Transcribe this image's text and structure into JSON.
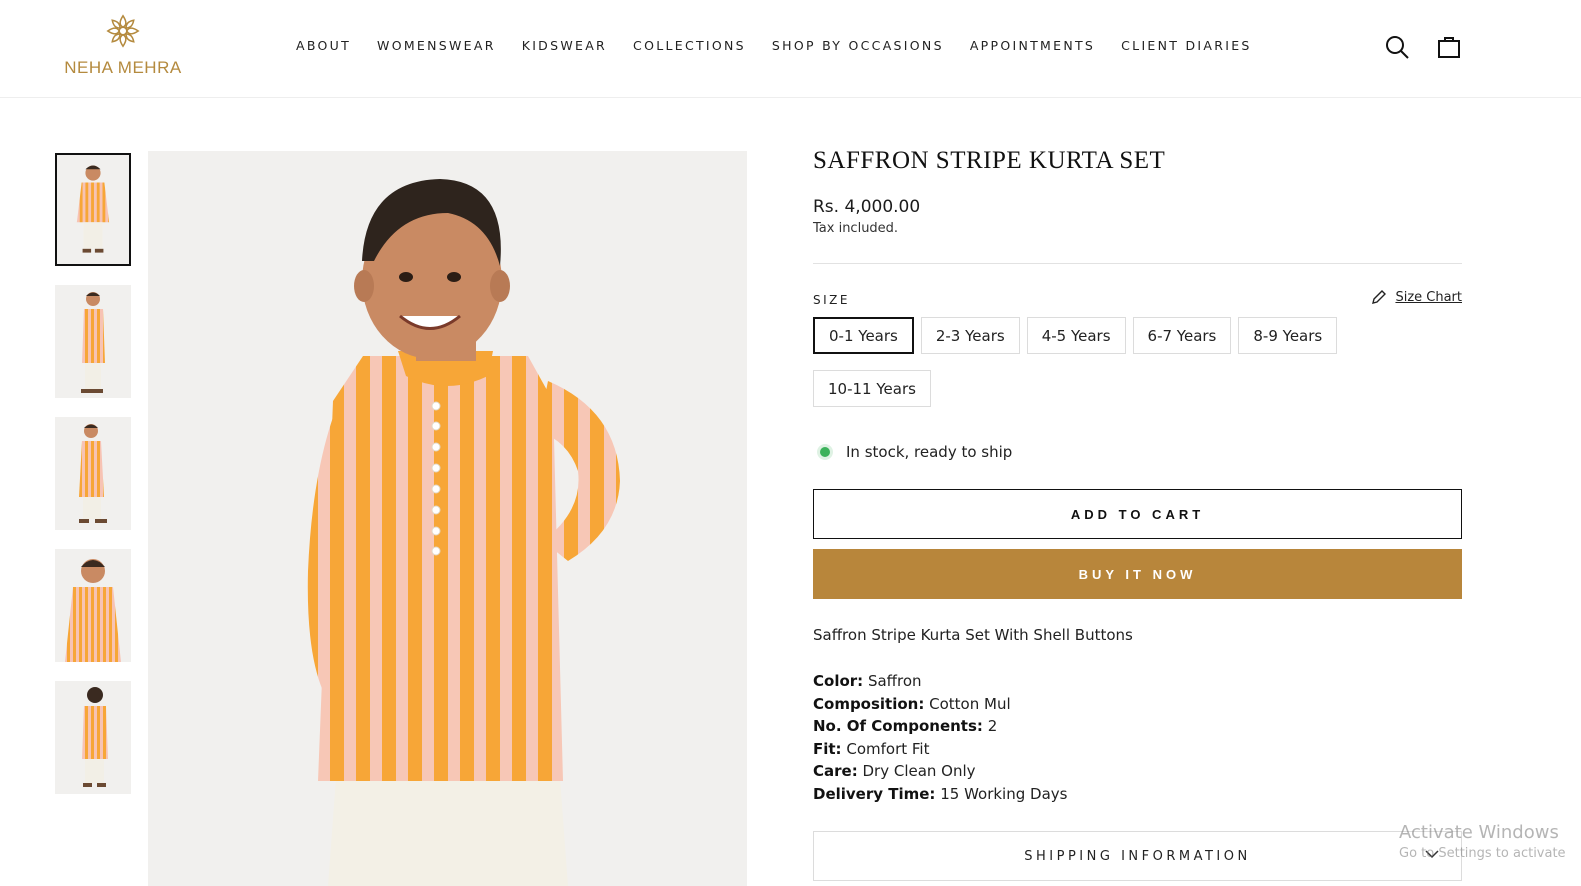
{
  "brand": {
    "name": "NEHA MEHRA",
    "color": "#b48a3e"
  },
  "nav": {
    "items": [
      "ABOUT",
      "WOMENSWEAR",
      "KIDSWEAR",
      "COLLECTIONS",
      "SHOP BY OCCASIONS",
      "APPOINTMENTS",
      "CLIENT DIARIES"
    ]
  },
  "header_icons": {
    "search": "search-icon",
    "cart": "bag-icon"
  },
  "gallery": {
    "thumbnails": [
      "front-view",
      "side-view",
      "side-view-2",
      "close-front-view",
      "back-view"
    ],
    "active_index": 0
  },
  "product": {
    "title": "SAFFRON STRIPE KURTA SET",
    "price": "Rs. 4,000.00",
    "tax_note": "Tax included.",
    "size_label": "SIZE",
    "size_chart_label": "Size Chart",
    "sizes": [
      "0-1 Years",
      "2-3 Years",
      "4-5 Years",
      "6-7 Years",
      "8-9 Years",
      "10-11 Years"
    ],
    "selected_size": "0-1 Years",
    "stock_text": "In stock, ready to ship",
    "add_to_cart": "ADD TO CART",
    "buy_now": "BUY IT NOW",
    "description": "Saffron Stripe Kurta Set With Shell Buttons",
    "specs": [
      {
        "label": "Color:",
        "value": "Saffron"
      },
      {
        "label": "Composition:",
        "value": "Cotton Mul"
      },
      {
        "label": "No. Of Components:",
        "value": "2"
      },
      {
        "label": "Fit:",
        "value": "Comfort Fit"
      },
      {
        "label": "Care:",
        "value": "Dry Clean Only"
      },
      {
        "label": "Delivery Time:",
        "value": "15 Working Days"
      }
    ],
    "shipping_label": "SHIPPING INFORMATION"
  },
  "colors": {
    "accent": "#b8863b",
    "stock": "#3bb25b",
    "kurta_orange": "#f7a637",
    "kurta_pink": "#f7c3b4"
  },
  "watermark": {
    "line1": "Activate Windows",
    "line2": "Go to Settings to activate"
  }
}
